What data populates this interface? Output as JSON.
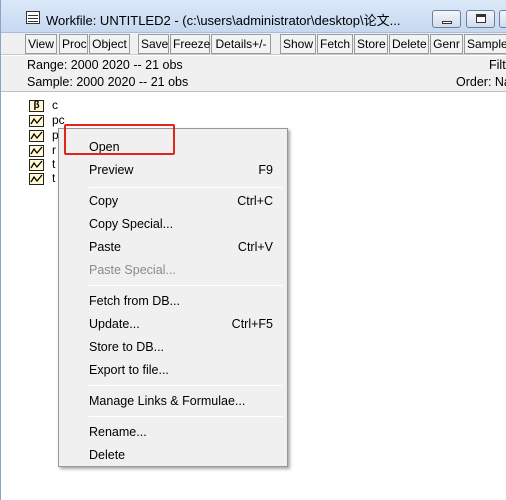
{
  "window": {
    "title": "Workfile: UNTITLED2 - (c:\\users\\administrator\\desktop\\论文..."
  },
  "toolbar": {
    "buttons": [
      "View",
      "Proc",
      "Object",
      "Save",
      "Freeze",
      "Details+/-",
      "Show",
      "Fetch",
      "Store",
      "Delete",
      "Genr",
      "Sample"
    ]
  },
  "info": {
    "range": "Range:  2000 2020  --  21 obs",
    "sample": "Sample: 2000 2020  --  21 obs",
    "filter": "Filt",
    "order": "Order: Na"
  },
  "objects": [
    {
      "icon": "coefficient-icon",
      "label": "c"
    },
    {
      "icon": "series-icon",
      "label": "pc"
    },
    {
      "icon": "series-icon",
      "label": "p"
    },
    {
      "icon": "series-icon",
      "label": "r"
    },
    {
      "icon": "series-icon",
      "label": "t"
    },
    {
      "icon": "series-icon",
      "label": "t"
    }
  ],
  "context_menu": {
    "items": [
      {
        "label": "Open",
        "shortcut": ""
      },
      {
        "label": "Preview",
        "shortcut": "F9"
      },
      {
        "label": "Copy",
        "shortcut": "Ctrl+C"
      },
      {
        "label": "Copy Special...",
        "shortcut": ""
      },
      {
        "label": "Paste",
        "shortcut": "Ctrl+V"
      },
      {
        "label": "Paste Special...",
        "shortcut": "",
        "disabled": true
      },
      {
        "label": "Fetch from DB...",
        "shortcut": ""
      },
      {
        "label": "Update...",
        "shortcut": "Ctrl+F5"
      },
      {
        "label": "Store to DB...",
        "shortcut": ""
      },
      {
        "label": "Export to file...",
        "shortcut": ""
      },
      {
        "label": "Manage Links & Formulae...",
        "shortcut": ""
      },
      {
        "label": "Rename...",
        "shortcut": ""
      },
      {
        "label": "Delete",
        "shortcut": ""
      }
    ]
  },
  "colors": {
    "highlight_outline": "#e0261c",
    "disabled_text": "#8a8a8a"
  }
}
